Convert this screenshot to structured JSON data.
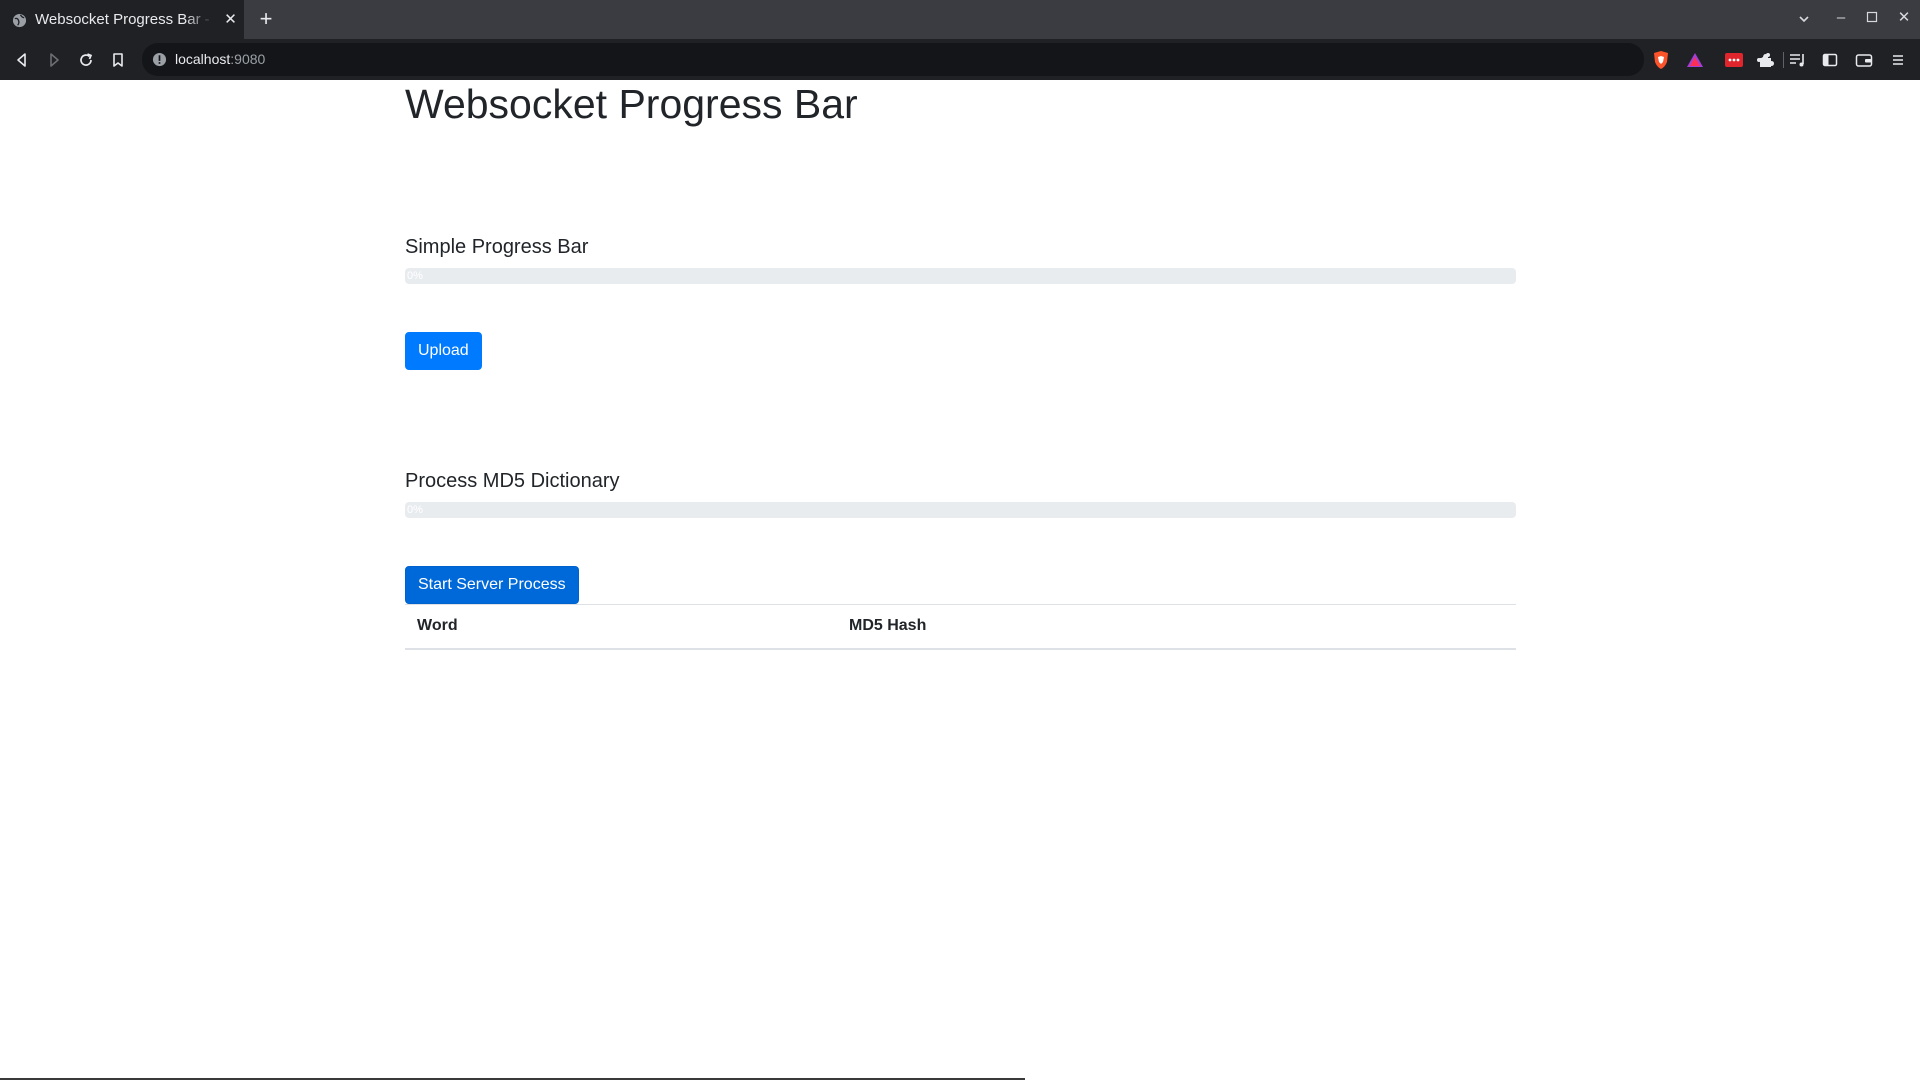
{
  "browser": {
    "tab_title": "Websocket Progress Bar - ",
    "url_host": "localhost",
    "url_port": ":9080"
  },
  "page": {
    "title": "Websocket Progress Bar",
    "simple": {
      "heading": "Simple Progress Bar",
      "progress_label": "0%",
      "progress_value": 0,
      "button_label": "Upload"
    },
    "process": {
      "heading": "Process MD5 Dictionary",
      "progress_label": "0%",
      "progress_value": 0,
      "button_label": "Start Server Process"
    },
    "table": {
      "columns": [
        "Word",
        "MD5 Hash"
      ]
    }
  },
  "colors": {
    "primary": "#007bff",
    "progress_track": "#e9ecef",
    "chrome_bg": "#202124"
  },
  "icons": {
    "favicon": "globe-icon",
    "back": "back-icon",
    "forward": "forward-icon",
    "reload": "reload-icon",
    "bookmark": "bookmark-icon",
    "share": "share-icon",
    "brave": "brave-shield-icon",
    "rewards": "brave-rewards-icon",
    "extensions": "puzzle-icon"
  }
}
